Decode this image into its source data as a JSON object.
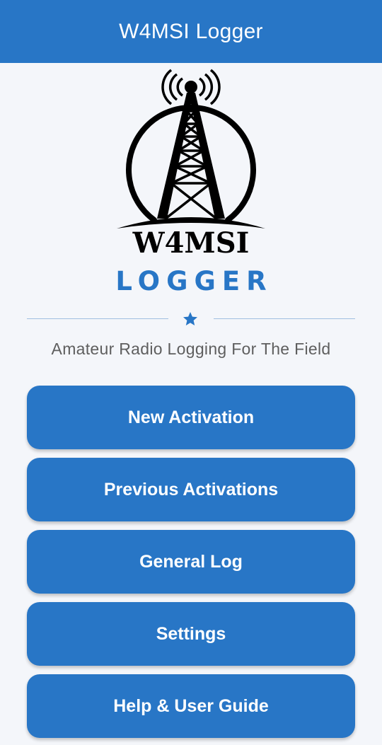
{
  "app_bar": {
    "title": "W4MSI Logger"
  },
  "logo": {
    "icon": "radio-tower-logo",
    "wordmark": "W4MSI"
  },
  "brand": {
    "subtitle": "LOGGER",
    "divider_icon": "star-icon"
  },
  "tagline": "Amateur Radio Logging For The Field",
  "menu": {
    "new_activation": "New Activation",
    "previous_activations": "Previous Activations",
    "general_log": "General Log",
    "settings": "Settings",
    "help": "Help & User Guide"
  },
  "colors": {
    "primary": "#2876c6",
    "background": "#f4f6fa",
    "tagline_text": "#5e5e5e",
    "logo_ink": "#000000"
  }
}
